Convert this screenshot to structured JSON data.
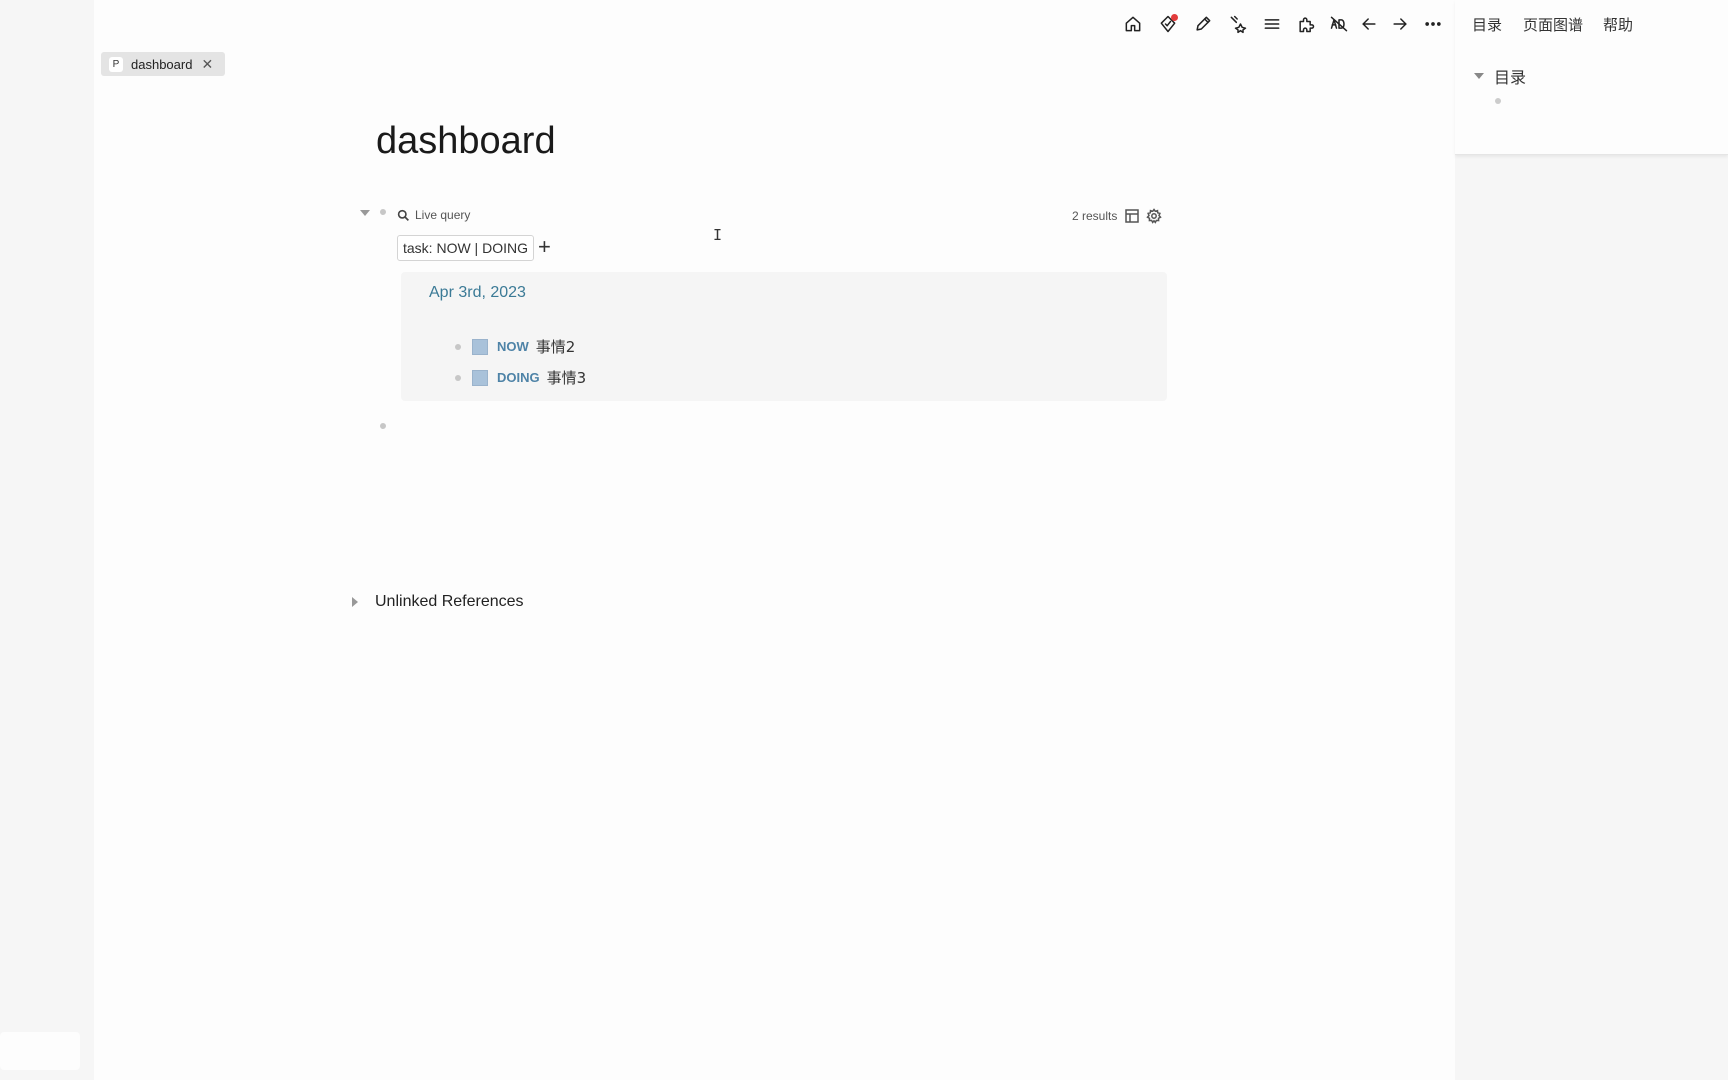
{
  "right_panel": {
    "tabs": [
      "目录",
      "页面图谱",
      "帮助"
    ],
    "toc_heading": "目录"
  },
  "toolbar": {
    "icons": [
      "home-icon",
      "tag-notification-icon",
      "pencil-icon",
      "star-sparkle-icon",
      "list-icon",
      "puzzle-icon",
      "no-ads-icon",
      "back-arrow-icon",
      "forward-arrow-icon",
      "more-icon"
    ]
  },
  "page_tab": {
    "badge": "P",
    "label": "dashboard",
    "close": "✕"
  },
  "page": {
    "title": "dashboard",
    "query": {
      "label": "Live query",
      "results_count": "2 results",
      "filter": "task: NOW | DOING",
      "add": "+",
      "date": "Apr 3rd, 2023",
      "tasks": [
        {
          "marker": "NOW",
          "text": "事情2"
        },
        {
          "marker": "DOING",
          "text": "事情3"
        }
      ]
    },
    "cursor": "I",
    "unlinked_references": "Unlinked References"
  },
  "colors": {
    "accent_link": "#3b7a96",
    "task_marker": "#4e83a7",
    "checkbox": "#a9c2da"
  }
}
